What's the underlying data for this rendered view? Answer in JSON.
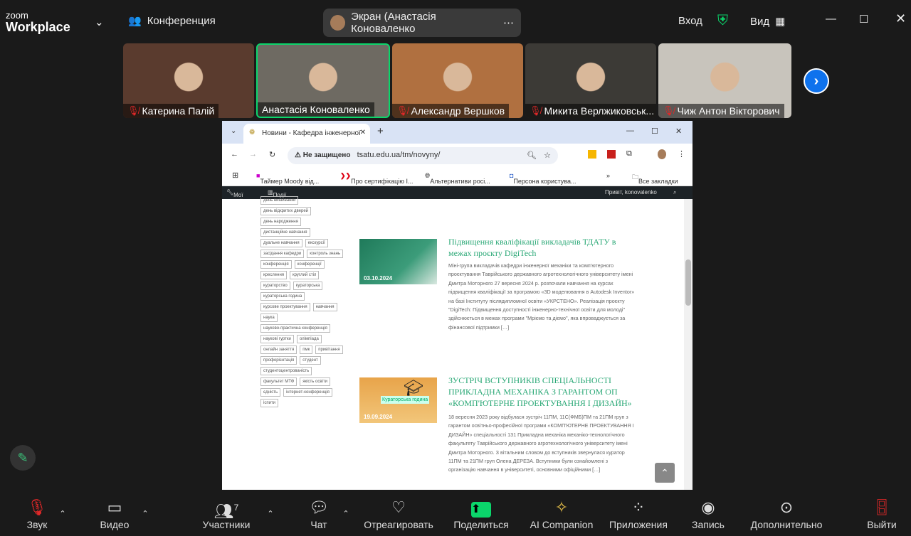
{
  "app": {
    "logo_small": "zoom",
    "logo_big": "Workplace",
    "meeting_label": "Конференция",
    "share_pill": "Экран (Анастасія Коноваленко",
    "login": "Вход",
    "view": "Вид"
  },
  "participants": [
    {
      "name": "Катерина Палій",
      "muted": true,
      "color": "#5a3b2e"
    },
    {
      "name": "Анастасія Коноваленко",
      "muted": false,
      "color": "#6e6a62"
    },
    {
      "name": "Александр Вершков",
      "muted": true,
      "color": "#b07040"
    },
    {
      "name": "Микита Верлжиковськ...",
      "muted": true,
      "color": "#3c3a36"
    },
    {
      "name": "Чиж Антон Вікторович",
      "muted": true,
      "color": "#c8c4bc"
    }
  ],
  "browser": {
    "tab_title": "Новини - Кафедра інженерної",
    "security": "Не защищено",
    "url": "tsatu.edu.ua/tm/novyny/",
    "bookmarks": [
      "Таймер Moody від...",
      "Про сертифікацію І...",
      "Альтернативи росі...",
      "Персона користува...",
      "»",
      "Все закладки"
    ],
    "wp_bar": {
      "sites": "Мої сайти",
      "events": "Події",
      "greeting": "Привіт, konovalenko"
    }
  },
  "tags": [
    "день вишиванки",
    "день відкритих дверей",
    "день народження",
    "дистанційне навчання",
    "дуальне навчання",
    "екскурсії",
    "засідання кафедри",
    "контроль знань",
    "конференція",
    "конференції",
    "креслення",
    "круглий стіл",
    "кураторство",
    "кураторська",
    "кураторська година",
    "курсове проектування",
    "навчання",
    "наука",
    "науково-практична конференція",
    "наукові гуртки",
    "олімпіада",
    "онлайн заняття",
    "пмк",
    "привітання",
    "профорієнтація",
    "студент",
    "студентоцентрованість",
    "факультет МТФ",
    "якість освіти",
    "єдність",
    "інтернет-конференція",
    "іспити"
  ],
  "posts": [
    {
      "date": "03.10.2024",
      "title": "Підвищення кваліфікації викладачів ТДАТУ в межах проєкту DigiTech",
      "text": "Міні-група викладачів кафедри інженерної механіки та комп'ютерного проєктування Таврійського державного агротехнологічного університету імені Дмитра Моторного 27 вересня 2024 р. розпочали навчання на курсах підвищення кваліфікації за програмою «3D моделювання в Autodesk Inventor» на базі Інституту післядипломної освіти «УКРСТЕНО». Реалізація проєкту \"DigiTech: Підвищення доступності інженерно-технічної освіти для молоді\" здійснюється в межах програми \"Мріємо та діємо\", яка впроваджується за фінансової підтримки […]"
    },
    {
      "date": "19.09.2024",
      "title": "ЗУСТРІЧ ВСТУПНИКІВ СПЕЦІАЛЬНОСТІ ПРИКЛАДНА МЕХАНІКА З ГАРАНТОМ ОП «КОМП'ЮТЕРНЕ ПРОЕКТУВАННЯ І ДИЗАЙН»",
      "img_caption": "Кураторська година",
      "text": "18 вересня 2023 року відбулася зустріч 11ПМ, 11С(ФМБ)ПМ та 21ПМ груп з гарантом освітньо-професійної програми «КОМП'ЮТЕРНЕ ПРОЕКТУВАННЯ І ДИЗАЙН» спеціальності 131 Прикладна механіка механіко-технологічного факультету Таврійського державного агротехнологічного університету імені Дмитра Моторного. З вітальним словом до вступників звернулася куратор 11ПМ та 21ПМ груп Олена ДЕРЕЗА. Вступники були ознайомлені з організацію навчання в університеті, основними офіційними […]"
    }
  ],
  "toolbar": {
    "audio": "Звук",
    "video": "Видео",
    "participants": "Участники",
    "participants_count": "7",
    "chat": "Чат",
    "react": "Отреагировать",
    "share": "Поделиться",
    "ai": "AI Companion",
    "apps": "Приложения",
    "record": "Запись",
    "more": "Дополнительно",
    "leave": "Выйти"
  },
  "colors": {
    "share_green": "#0bd66b",
    "accent": "#0e72ed",
    "leave": "#e02828",
    "link": "#2aa876"
  }
}
